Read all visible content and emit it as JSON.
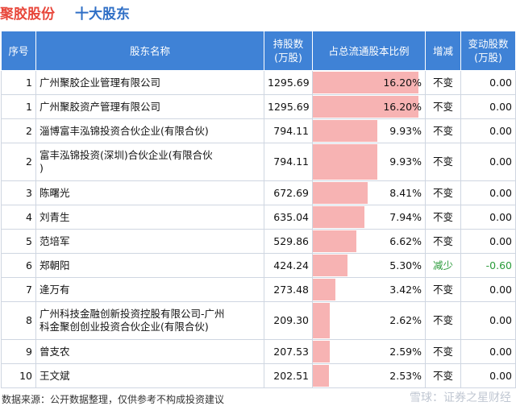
{
  "header": {
    "company": "聚胶股份",
    "title": "十大股东"
  },
  "table": {
    "headers": {
      "seq": "序号",
      "name": "股东名称",
      "shares_line1": "持股数",
      "shares_line2": "(万股)",
      "ratio": "占总流通股本比例",
      "change_type": "增减",
      "change_line1": "变动股数",
      "change_line2": "(万股)"
    },
    "rows": [
      {
        "seq": "1",
        "name": "广州聚胶企业管理有限公司",
        "shares": "1295.69",
        "ratio": "16.20%",
        "ratio_value": 16.2,
        "change_type": "不变",
        "change": "0.00"
      },
      {
        "seq": "1",
        "name": "广州聚胶资产管理有限公司",
        "shares": "1295.69",
        "ratio": "16.20%",
        "ratio_value": 16.2,
        "change_type": "不变",
        "change": "0.00"
      },
      {
        "seq": "2",
        "name": "淄博富丰泓锦投资合伙企业(有限合伙)",
        "shares": "794.11",
        "ratio": "9.93%",
        "ratio_value": 9.93,
        "change_type": "不变",
        "change": "0.00"
      },
      {
        "seq": "2",
        "name": "富丰泓锦投资(深圳)合伙企业(有限合伙\n)",
        "shares": "794.11",
        "ratio": "9.93%",
        "ratio_value": 9.93,
        "change_type": "不变",
        "change": "0.00"
      },
      {
        "seq": "3",
        "name": "陈曙光",
        "shares": "672.69",
        "ratio": "8.41%",
        "ratio_value": 8.41,
        "change_type": "不变",
        "change": "0.00"
      },
      {
        "seq": "4",
        "name": "刘青生",
        "shares": "635.04",
        "ratio": "7.94%",
        "ratio_value": 7.94,
        "change_type": "不变",
        "change": "0.00"
      },
      {
        "seq": "5",
        "name": "范培军",
        "shares": "529.86",
        "ratio": "6.62%",
        "ratio_value": 6.62,
        "change_type": "不变",
        "change": "0.00"
      },
      {
        "seq": "6",
        "name": "郑朝阳",
        "shares": "424.24",
        "ratio": "5.30%",
        "ratio_value": 5.3,
        "change_type": "减少",
        "change": "-0.60"
      },
      {
        "seq": "7",
        "name": "逄万有",
        "shares": "273.48",
        "ratio": "3.42%",
        "ratio_value": 3.42,
        "change_type": "不变",
        "change": "0.00"
      },
      {
        "seq": "8",
        "name": "广州科技金融创新投资控股有限公司-广州\n科金聚创创业投资合伙企业(有限合伙)",
        "shares": "209.30",
        "ratio": "2.62%",
        "ratio_value": 2.62,
        "change_type": "不变",
        "change": "0.00"
      },
      {
        "seq": "9",
        "name": "曾支农",
        "shares": "207.53",
        "ratio": "2.59%",
        "ratio_value": 2.59,
        "change_type": "不变",
        "change": "0.00"
      },
      {
        "seq": "10",
        "name": "王文斌",
        "shares": "202.51",
        "ratio": "2.53%",
        "ratio_value": 2.53,
        "change_type": "不变",
        "change": "0.00"
      }
    ]
  },
  "footer": {
    "source": "数据来源：公开数据整理，仅供参考不构成投资建议",
    "brand": "雪球：证券之星财经"
  },
  "colors": {
    "header_bg": "#3f82d6",
    "bar": "#f7b3b3",
    "decrease": "#2a9b3a",
    "company": "#e8463a",
    "title": "#2f6fc6"
  }
}
